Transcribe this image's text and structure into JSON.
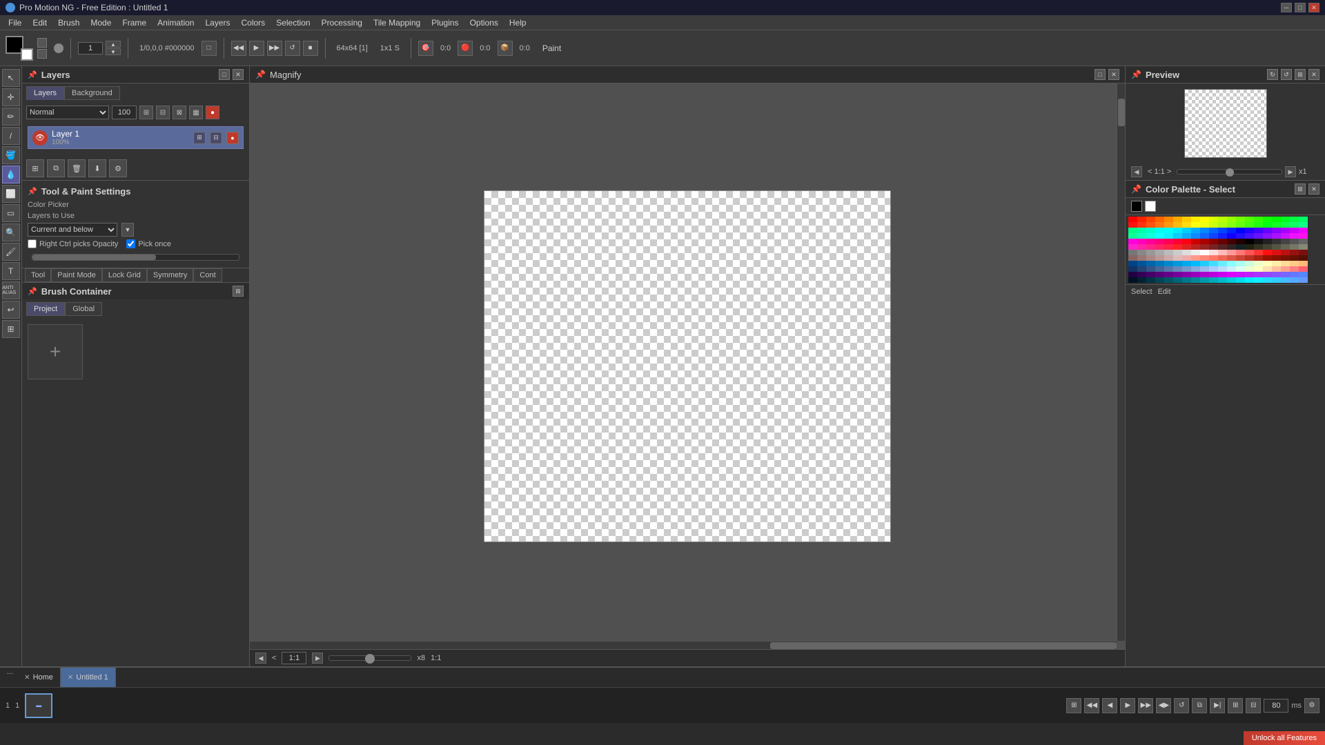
{
  "titlebar": {
    "title": "Pro Motion NG - Free Edition : Untitled 1",
    "controls": [
      "minimize",
      "maximize",
      "close"
    ]
  },
  "menubar": {
    "items": [
      "File",
      "Edit",
      "Brush",
      "Mode",
      "Frame",
      "Animation",
      "Layers",
      "Colors",
      "Selection",
      "Processing",
      "Tile Mapping",
      "Plugins",
      "Options",
      "Help"
    ]
  },
  "toolbar": {
    "color_info": "1/0,0,0 #000000",
    "size_label": "1",
    "canvas_info": "64x64 [1]",
    "zoom_info": "1x1 S",
    "pos1": "0:0",
    "pos2": "0:0",
    "pos3": "0:0",
    "paint_label": "Paint"
  },
  "layers_panel": {
    "title": "Layers",
    "tabs": [
      "Layers",
      "Background"
    ],
    "blend_mode": "Normal",
    "opacity": "100",
    "layer1": {
      "name": "Layer 1",
      "opacity": "100%"
    }
  },
  "tool_settings": {
    "title": "Tool & Paint Settings",
    "subtitle": "Color Picker",
    "layers_to_use_label": "Layers to Use",
    "layers_to_use_value": "Current and below",
    "right_ctrl_label": "Right Ctrl picks Opacity",
    "pick_once_label": "Pick once",
    "tabs": [
      "Tool",
      "Paint Mode",
      "Lock Grid",
      "Symmetry",
      "Cont"
    ]
  },
  "brush_container": {
    "title": "Brush Container",
    "tabs": [
      "Project",
      "Global"
    ],
    "add_btn": "+"
  },
  "canvas": {
    "title": "Magnify",
    "zoom_value": "1:1",
    "zoom_x": "x8",
    "zoom_ratio": "1:1"
  },
  "preview": {
    "title": "Preview",
    "zoom_label": "< 1:1 >"
  },
  "color_palette": {
    "title": "Color Palette - Select",
    "select_label": "Select",
    "edit_label": "Edit"
  },
  "tabs_bar": {
    "home_tab": "Home",
    "untitled_tab": "Untitled 1",
    "dots": "..."
  },
  "filmstrip": {
    "frame_num": "1",
    "frame_count": "1",
    "fps": "80",
    "ms_label": "ms"
  },
  "unlock_banner": "Unlock all Features"
}
